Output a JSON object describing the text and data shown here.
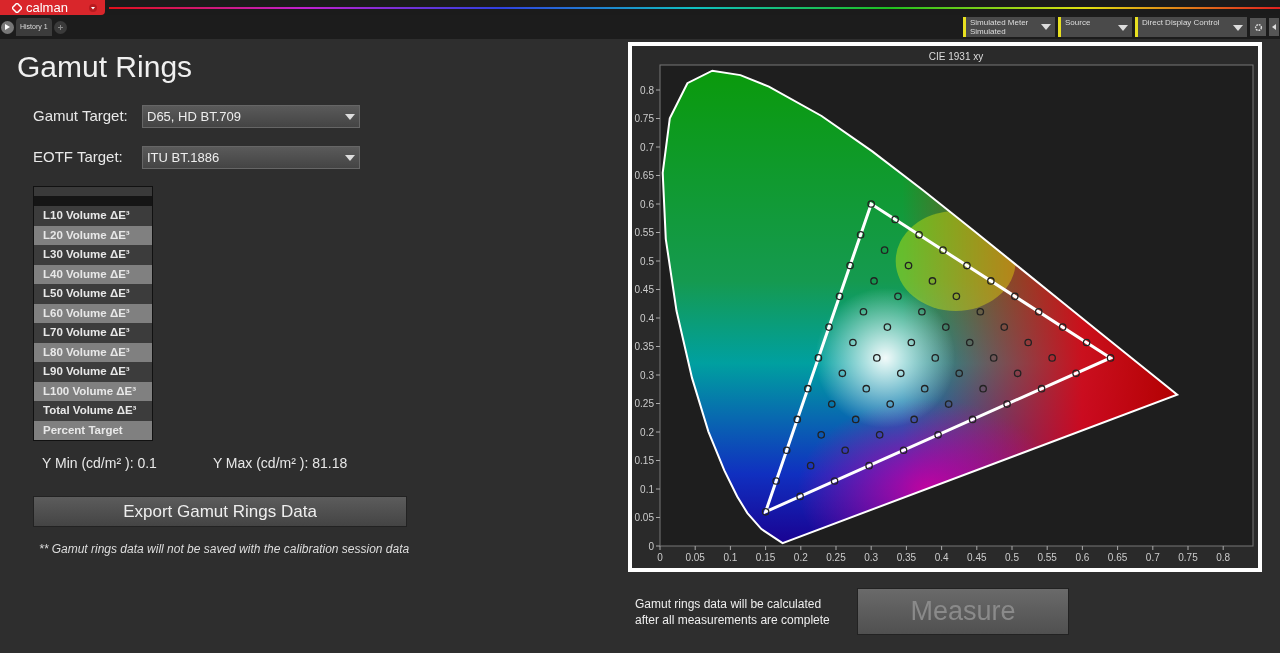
{
  "app": {
    "logo": "calman"
  },
  "tabs": [
    {
      "label": "History 1",
      "selected": true
    }
  ],
  "toolbar": {
    "meter": {
      "label": "Simulated Meter",
      "value": "Simulated"
    },
    "source": {
      "label": "Source"
    },
    "display_control": {
      "label": "Direct Display Control"
    }
  },
  "title": "Gamut Rings",
  "gamut_target": {
    "label": "Gamut Target:",
    "value": "D65, HD BT.709"
  },
  "eotf_target": {
    "label": "EOTF Target:",
    "value": "ITU BT.1886"
  },
  "results_table": {
    "rows": [
      "L10 Volume ΔE³",
      "L20 Volume ΔE³",
      "L30 Volume ΔE³",
      "L40 Volume ΔE³",
      "L50 Volume ΔE³",
      "L60 Volume ΔE³",
      "L70 Volume ΔE³",
      "L80 Volume ΔE³",
      "L90 Volume ΔE³",
      "L100 Volume ΔE³",
      "Total Volume ΔE³",
      "Percent Target"
    ]
  },
  "y_min": "Y Min (cd/m² ): 0.1",
  "y_max": "Y Max (cd/m² ): 81.18",
  "export_button": "Export Gamut Rings Data",
  "note": "** Gamut rings data will not be saved with the calibration session data",
  "chart": {
    "title": "CIE 1931 xy",
    "x_ticks": [
      "0",
      "0.05",
      "0.1",
      "0.15",
      "0.2",
      "0.25",
      "0.3",
      "0.35",
      "0.4",
      "0.45",
      "0.5",
      "0.55",
      "0.6",
      "0.65",
      "0.7",
      "0.75",
      "0.8"
    ],
    "y_ticks": [
      "0.8",
      "0.75",
      "0.7",
      "0.65",
      "0.6",
      "0.55",
      "0.5",
      "0.45",
      "0.4",
      "0.35",
      "0.3",
      "0.25",
      "0.2",
      "0.15",
      "0.1",
      "0.05",
      "0"
    ]
  },
  "status": "Gamut rings data will be calculated after all measurements are complete",
  "measure_button": {
    "label": "Measure",
    "disabled": true
  }
}
